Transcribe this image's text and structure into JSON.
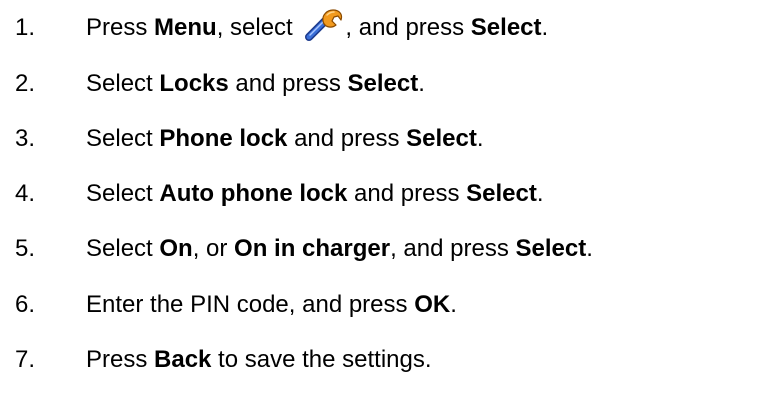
{
  "steps": [
    {
      "number": "1.",
      "parts": [
        {
          "t": "Press ",
          "bold": false
        },
        {
          "t": "Menu",
          "bold": true
        },
        {
          "t": ", select ",
          "bold": false
        },
        {
          "icon": "wrench-icon"
        },
        {
          "t": ", and press ",
          "bold": false
        },
        {
          "t": "Select",
          "bold": true
        },
        {
          "t": ".",
          "bold": false
        }
      ]
    },
    {
      "number": "2.",
      "parts": [
        {
          "t": "Select ",
          "bold": false
        },
        {
          "t": "Locks",
          "bold": true
        },
        {
          "t": " and press ",
          "bold": false
        },
        {
          "t": "Select",
          "bold": true
        },
        {
          "t": ".",
          "bold": false
        }
      ]
    },
    {
      "number": "3.",
      "parts": [
        {
          "t": "Select ",
          "bold": false
        },
        {
          "t": "Phone lock",
          "bold": true
        },
        {
          "t": " and press ",
          "bold": false
        },
        {
          "t": "Select",
          "bold": true
        },
        {
          "t": ".",
          "bold": false
        }
      ]
    },
    {
      "number": "4.",
      "parts": [
        {
          "t": "Select ",
          "bold": false
        },
        {
          "t": "Auto phone lock",
          "bold": true
        },
        {
          "t": " and press ",
          "bold": false
        },
        {
          "t": "Select",
          "bold": true
        },
        {
          "t": ".",
          "bold": false
        }
      ]
    },
    {
      "number": "5.",
      "parts": [
        {
          "t": "Select ",
          "bold": false
        },
        {
          "t": "On",
          "bold": true
        },
        {
          "t": ", or ",
          "bold": false
        },
        {
          "t": "On in charger",
          "bold": true
        },
        {
          "t": ", and press ",
          "bold": false
        },
        {
          "t": "Select",
          "bold": true
        },
        {
          "t": ".",
          "bold": false
        }
      ]
    },
    {
      "number": "6.",
      "parts": [
        {
          "t": "Enter the PIN code, and press ",
          "bold": false
        },
        {
          "t": "OK",
          "bold": true
        },
        {
          "t": ".",
          "bold": false
        }
      ]
    },
    {
      "number": "7.",
      "parts": [
        {
          "t": "Press ",
          "bold": false
        },
        {
          "t": "Back",
          "bold": true
        },
        {
          "t": " to save the settings.",
          "bold": false
        }
      ]
    }
  ],
  "colors": {
    "text": "#000000",
    "background": "#ffffff",
    "icon_blue": "#3a6fd8",
    "icon_orange": "#f29a1e"
  }
}
